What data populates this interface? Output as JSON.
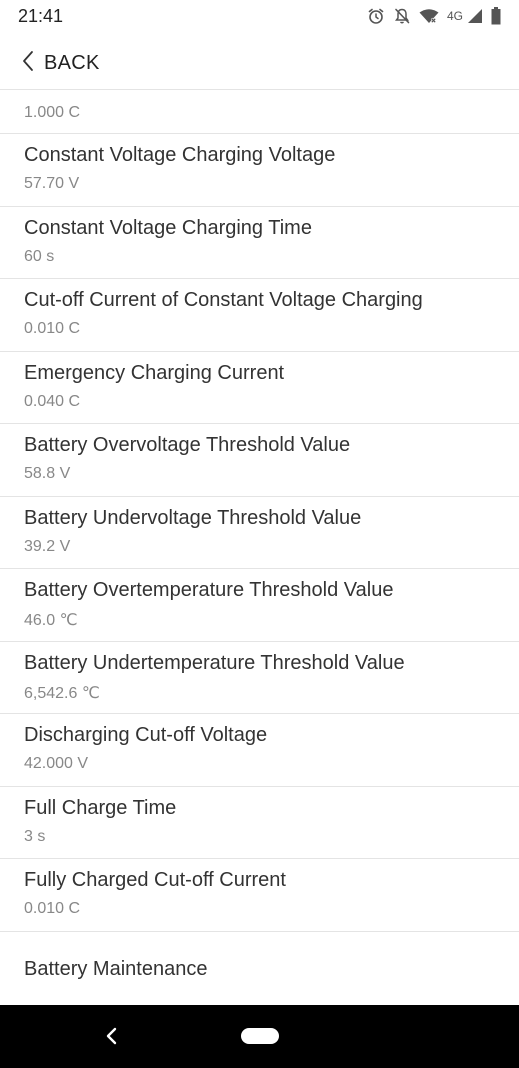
{
  "status_bar": {
    "time": "21:41",
    "network": "4G",
    "icons": [
      "alarm-icon",
      "notifications-off-icon",
      "wifi-icon",
      "cell-signal-icon",
      "battery-icon"
    ]
  },
  "header": {
    "back_label": "BACK",
    "back_icon": "chevron-left-icon"
  },
  "list": {
    "first_item_value": "1.000 C",
    "items": [
      {
        "title": "Constant Voltage Charging Voltage",
        "value": "57.70 V"
      },
      {
        "title": "Constant Voltage Charging Time",
        "value": "60 s"
      },
      {
        "title": "Cut-off Current of Constant Voltage Charging",
        "value": "0.010 C"
      },
      {
        "title": "Emergency Charging Current",
        "value": "0.040 C"
      },
      {
        "title": "Battery Overvoltage Threshold Value",
        "value": "58.8 V"
      },
      {
        "title": "Battery Undervoltage Threshold Value",
        "value": "39.2 V"
      },
      {
        "title": "Battery Overtemperature Threshold Value",
        "value": "46.0 ℃"
      },
      {
        "title": "Battery Undertemperature Threshold Value",
        "value": "6,542.6 ℃"
      },
      {
        "title": "Discharging Cut-off Voltage",
        "value": "42.000 V"
      },
      {
        "title": "Full Charge Time",
        "value": "3 s"
      },
      {
        "title": "Fully Charged Cut-off Current",
        "value": "0.010 C"
      }
    ],
    "maintenance_label": "Battery Maintenance"
  },
  "nav_bar": {
    "back_icon": "nav-back-icon",
    "home_icon": "nav-home-pill-icon"
  }
}
